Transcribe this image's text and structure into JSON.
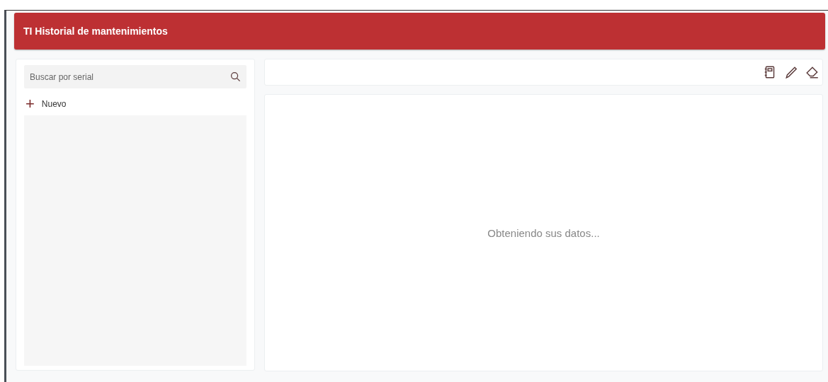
{
  "header": {
    "title": "TI Historial de mantenimientos"
  },
  "sidebar": {
    "search": {
      "placeholder": "Buscar por serial"
    },
    "new_button": {
      "icon": "+",
      "label": "Nuevo"
    }
  },
  "toolbar": {
    "buttons": [
      {
        "kind": "notebook"
      },
      {
        "kind": "pencil"
      },
      {
        "kind": "eraser"
      }
    ]
  },
  "content": {
    "message": "Obteniendo sus datos..."
  }
}
